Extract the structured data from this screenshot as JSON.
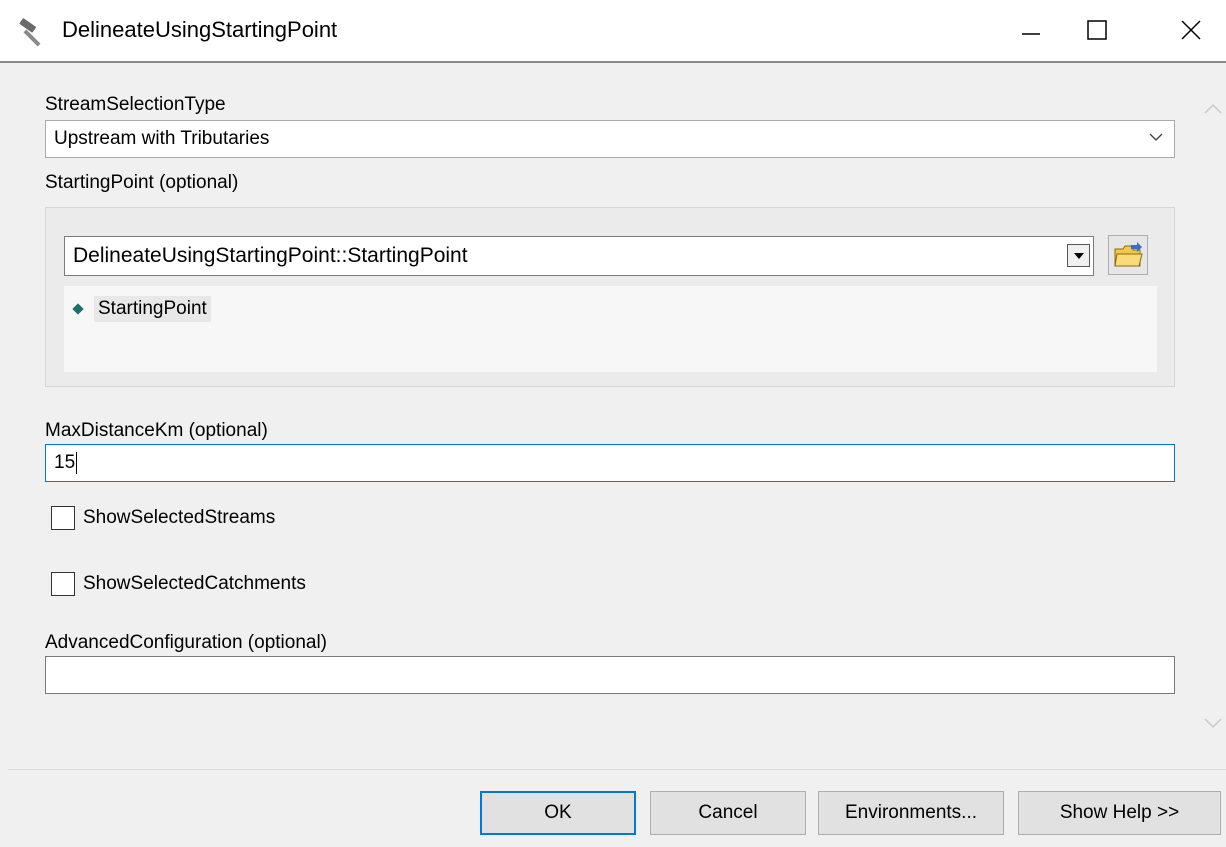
{
  "window": {
    "title": "DelineateUsingStartingPoint",
    "icon": "hammer-icon"
  },
  "form": {
    "stream_selection_label": "StreamSelectionType",
    "stream_selection_value": "Upstream with Tributaries",
    "starting_point_label": "StartingPoint (optional)",
    "starting_point_combo_value": "DelineateUsingStartingPoint::StartingPoint",
    "starting_point_items": [
      "StartingPoint"
    ],
    "max_distance_label": "MaxDistanceKm (optional)",
    "max_distance_value": "15",
    "show_streams_label": "ShowSelectedStreams",
    "show_streams_checked": false,
    "show_catchments_label": "ShowSelectedCatchments",
    "show_catchments_checked": false,
    "advanced_config_label": "AdvancedConfiguration (optional)",
    "advanced_config_value": ""
  },
  "buttons": {
    "ok": "OK",
    "cancel": "Cancel",
    "environments": "Environments...",
    "show_help": "Show Help >>"
  },
  "colors": {
    "focus_border": "#0078d7",
    "point_marker": "#1f6e6e"
  }
}
